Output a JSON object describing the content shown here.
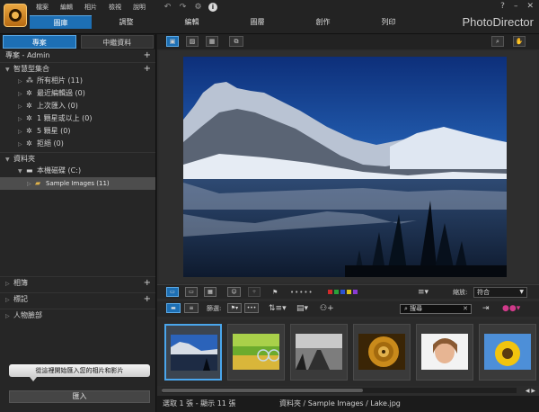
{
  "menu": [
    "檔案",
    "編輯",
    "相片",
    "檢視",
    "說明"
  ],
  "window_controls": [
    "?",
    "–",
    "✕"
  ],
  "mode_tabs": [
    "圖庫",
    "調整",
    "編輯",
    "圖層",
    "創作",
    "列印"
  ],
  "active_mode": "圖庫",
  "app_name": "PhotoDirector",
  "accent_color": "#1d6fb4",
  "left_panel": {
    "tabs": [
      "專案",
      "中繼資料"
    ],
    "project_header": "專案 - Admin",
    "smart_collections": {
      "title": "智慧型集合",
      "items": [
        "所有相片 (11)",
        "最近編輯過 (0)",
        "上次匯入 (0)",
        "1 顆星或以上 (0)",
        "5 顆星 (0)",
        "拒絕 (0)"
      ]
    },
    "folders": {
      "title": "資料夾",
      "drive": "本機磁碟 (C:)",
      "subfolder": "Sample Images (11)"
    },
    "albums": "相簿",
    "tags": "標記",
    "faces": "人物臉部",
    "hint_text": "從這裡開始匯入您的相片和影片",
    "import_button": "匯入"
  },
  "toolbar": {
    "zoom_label": "縮放:",
    "zoom_value": "符合",
    "filter_label": "篩選:",
    "search_text": "搜尋",
    "color_labels": [
      "#d22a2a",
      "#2aa23a",
      "#2a52d2",
      "#d8c21a",
      "#8a3ad2"
    ]
  },
  "thumbnails": [
    {
      "name": "Lake",
      "selected": true
    },
    {
      "name": "Bicycle",
      "selected": false
    },
    {
      "name": "Road",
      "selected": false
    },
    {
      "name": "Spiral",
      "selected": false
    },
    {
      "name": "Woman",
      "selected": false
    },
    {
      "name": "Sunflower",
      "selected": false
    }
  ],
  "status": {
    "selection": "選取 1 張 - 顯示 11 張",
    "path": "資料夾 / Sample Images / Lake.jpg"
  }
}
